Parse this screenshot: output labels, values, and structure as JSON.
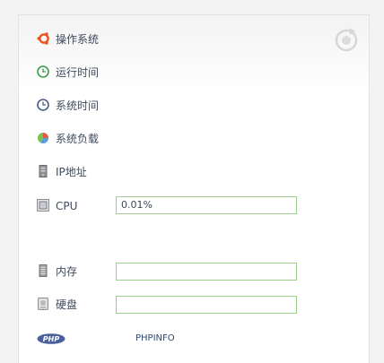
{
  "header": {
    "title": "操作系统"
  },
  "rows": {
    "uptime": {
      "label": "运行时间"
    },
    "systime": {
      "label": "系统时间"
    },
    "load": {
      "label": "系统负载"
    },
    "ip": {
      "label": "IP地址"
    },
    "cpu": {
      "label": "CPU",
      "value": "0.01%"
    },
    "memory": {
      "label": "内存",
      "value": ""
    },
    "disk": {
      "label": "硬盘",
      "value": ""
    },
    "php": {
      "badge": "PHP",
      "link": "PHPINFO"
    }
  },
  "icons": {
    "os": "ubuntu-icon",
    "uptime": "clock-green-icon",
    "systime": "clock-blue-icon",
    "load": "pie-chart-icon",
    "ip": "server-icon",
    "cpu": "cpu-icon",
    "memory": "memory-icon",
    "disk": "hard-disk-icon",
    "refresh": "refresh-icon"
  },
  "colors": {
    "field_border": "#9dcc8f",
    "ubuntu": "#e95420",
    "php": "#4a5f9e"
  }
}
